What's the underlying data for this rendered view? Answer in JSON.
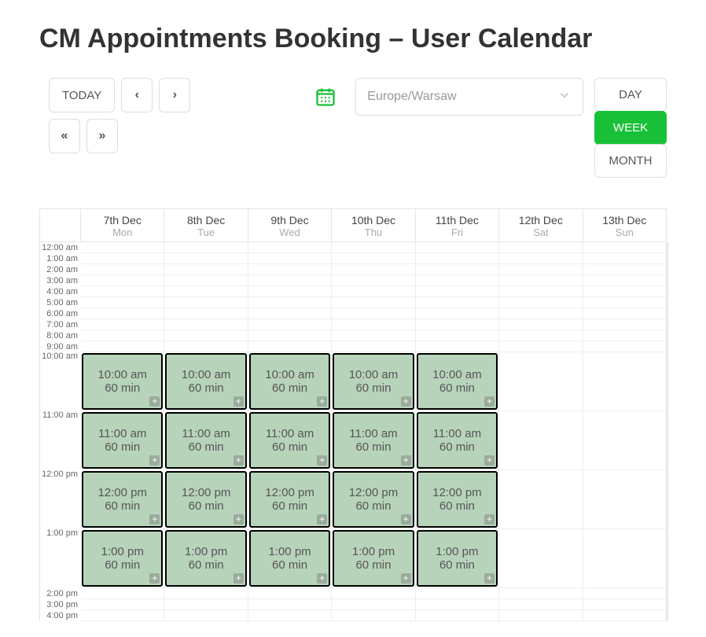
{
  "title": "CM Appointments Booking – User Calendar",
  "toolbar": {
    "today_label": "TODAY",
    "prev": "‹",
    "next": "›",
    "jump_prev": "«",
    "jump_next": "»"
  },
  "timezone": {
    "placeholder": "Europe/Warsaw"
  },
  "views": {
    "day": "DAY",
    "week": "WEEK",
    "month": "MONTH",
    "active": "week"
  },
  "days": [
    {
      "date": "7th Dec",
      "dow": "Mon"
    },
    {
      "date": "8th Dec",
      "dow": "Tue"
    },
    {
      "date": "9th Dec",
      "dow": "Wed"
    },
    {
      "date": "10th Dec",
      "dow": "Thu"
    },
    {
      "date": "11th Dec",
      "dow": "Fri"
    },
    {
      "date": "12th Dec",
      "dow": "Sat"
    },
    {
      "date": "13th Dec",
      "dow": "Sun"
    }
  ],
  "hours_compact_top": [
    "12:00 am",
    "1:00 am",
    "2:00 am",
    "3:00 am",
    "4:00 am",
    "5:00 am",
    "6:00 am",
    "7:00 am",
    "8:00 am",
    "9:00 am"
  ],
  "hours_expanded": [
    "10:00 am",
    "11:00 am",
    "12:00 pm",
    "1:00 pm"
  ],
  "hours_compact_bottom": [
    "2:00 pm",
    "3:00 pm",
    "4:00 pm"
  ],
  "slots": {
    "times": [
      "10:00 am",
      "11:00 am",
      "12:00 pm",
      "1:00 pm"
    ],
    "duration": "60 min",
    "day_indexes": [
      0,
      1,
      2,
      3,
      4
    ]
  }
}
